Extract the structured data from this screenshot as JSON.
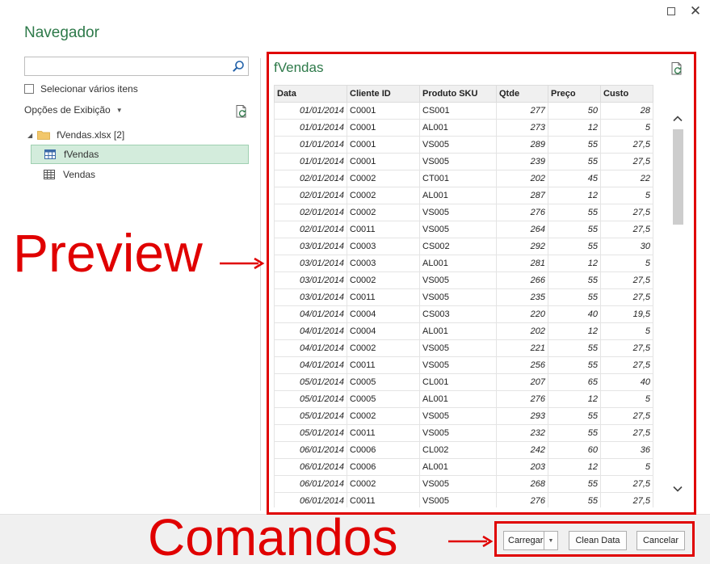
{
  "window": {
    "title": "Navegador",
    "maximize_label": "maximize",
    "close_label": "close"
  },
  "search": {
    "value": "",
    "placeholder": ""
  },
  "select_multiple": {
    "label": "Selecionar vários itens",
    "checked": false
  },
  "display_options": {
    "label": "Opções de Exibição"
  },
  "tree": {
    "parent": {
      "label": "fVendas.xlsx [2]",
      "icon": "folder-icon"
    },
    "items": [
      {
        "label": "fVendas",
        "icon": "table-icon",
        "selected": true
      },
      {
        "label": "Vendas",
        "icon": "sheet-icon",
        "selected": false
      }
    ]
  },
  "preview": {
    "title": "fVendas",
    "columns": [
      "Data",
      "Cliente ID",
      "Produto SKU",
      "Qtde",
      "Preço",
      "Custo"
    ],
    "rows": [
      [
        "01/01/2014",
        "C0001",
        "CS001",
        "277",
        "50",
        "28"
      ],
      [
        "01/01/2014",
        "C0001",
        "AL001",
        "273",
        "12",
        "5"
      ],
      [
        "01/01/2014",
        "C0001",
        "VS005",
        "289",
        "55",
        "27,5"
      ],
      [
        "01/01/2014",
        "C0001",
        "VS005",
        "239",
        "55",
        "27,5"
      ],
      [
        "02/01/2014",
        "C0002",
        "CT001",
        "202",
        "45",
        "22"
      ],
      [
        "02/01/2014",
        "C0002",
        "AL001",
        "287",
        "12",
        "5"
      ],
      [
        "02/01/2014",
        "C0002",
        "VS005",
        "276",
        "55",
        "27,5"
      ],
      [
        "02/01/2014",
        "C0011",
        "VS005",
        "264",
        "55",
        "27,5"
      ],
      [
        "03/01/2014",
        "C0003",
        "CS002",
        "292",
        "55",
        "30"
      ],
      [
        "03/01/2014",
        "C0003",
        "AL001",
        "281",
        "12",
        "5"
      ],
      [
        "03/01/2014",
        "C0002",
        "VS005",
        "266",
        "55",
        "27,5"
      ],
      [
        "03/01/2014",
        "C0011",
        "VS005",
        "235",
        "55",
        "27,5"
      ],
      [
        "04/01/2014",
        "C0004",
        "CS003",
        "220",
        "40",
        "19,5"
      ],
      [
        "04/01/2014",
        "C0004",
        "AL001",
        "202",
        "12",
        "5"
      ],
      [
        "04/01/2014",
        "C0002",
        "VS005",
        "221",
        "55",
        "27,5"
      ],
      [
        "04/01/2014",
        "C0011",
        "VS005",
        "256",
        "55",
        "27,5"
      ],
      [
        "05/01/2014",
        "C0005",
        "CL001",
        "207",
        "65",
        "40"
      ],
      [
        "05/01/2014",
        "C0005",
        "AL001",
        "276",
        "12",
        "5"
      ],
      [
        "05/01/2014",
        "C0002",
        "VS005",
        "293",
        "55",
        "27,5"
      ],
      [
        "05/01/2014",
        "C0011",
        "VS005",
        "232",
        "55",
        "27,5"
      ],
      [
        "06/01/2014",
        "C0006",
        "CL002",
        "242",
        "60",
        "36"
      ],
      [
        "06/01/2014",
        "C0006",
        "AL001",
        "203",
        "12",
        "5"
      ],
      [
        "06/01/2014",
        "C0002",
        "VS005",
        "268",
        "55",
        "27,5"
      ],
      [
        "06/01/2014",
        "C0011",
        "VS005",
        "276",
        "55",
        "27,5"
      ]
    ]
  },
  "buttons": {
    "load": "Carregar",
    "clean": "Clean Data",
    "cancel": "Cancelar"
  },
  "annotations": {
    "preview": "Preview",
    "commands": "Comandos",
    "color": "#e00000"
  },
  "colors": {
    "accent_green": "#2e7a4a",
    "selected_bg": "#d3ecdc"
  }
}
